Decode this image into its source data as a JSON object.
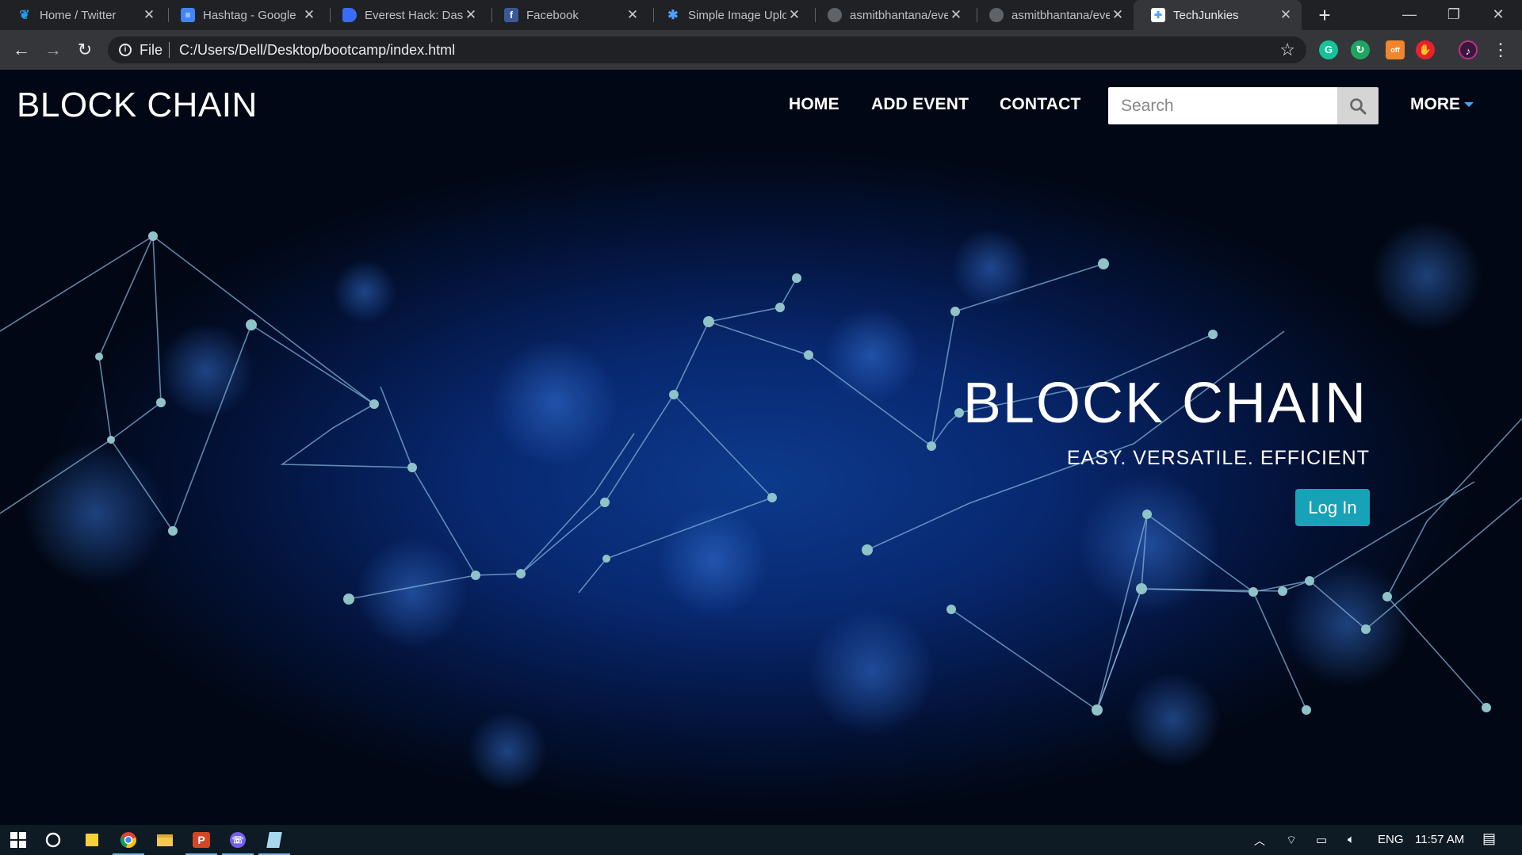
{
  "browser": {
    "tabs": [
      {
        "title": "Home / Twitter",
        "icon": "twitter-icon",
        "color": "#1da1f2",
        "glyph": "t"
      },
      {
        "title": "Hashtag - Google",
        "icon": "google-docs-icon",
        "color": "#4285f4",
        "glyph": "≡"
      },
      {
        "title": "Everest Hack: Dash",
        "icon": "everest-hack-icon",
        "color": "#3b6cf6",
        "glyph": "D"
      },
      {
        "title": "Facebook",
        "icon": "facebook-icon",
        "color": "#3b5998",
        "glyph": "f"
      },
      {
        "title": "Simple Image Uplo",
        "icon": "loading-spinner-icon",
        "color": "#202124",
        "glyph": "✱"
      },
      {
        "title": "asmitbhantana/eve",
        "icon": "github-icon",
        "color": "#202124",
        "glyph": "●"
      },
      {
        "title": "asmitbhantana/eve",
        "icon": "github-icon",
        "color": "#202124",
        "glyph": "●"
      },
      {
        "title": "TechJunkies",
        "icon": "techjunkies-icon",
        "color": "#ffffff",
        "glyph": "✚"
      }
    ],
    "active_tab": 7,
    "address": {
      "scheme": "File",
      "url": "C:/Users/Dell/Desktop/bootcamp/index.html"
    }
  },
  "page": {
    "brand": "BLOCK CHAIN",
    "nav": [
      "HOME",
      "ADD EVENT",
      "CONTACT"
    ],
    "search": {
      "placeholder": "Search"
    },
    "more": "MORE",
    "hero": {
      "title": "BLOCK CHAIN",
      "subtitle": "EASY. VERSATILE. EFFICIENT",
      "button": "Log In"
    },
    "accent_color": "#17a2b8"
  },
  "taskbar": {
    "language": "ENG",
    "time": "11:57 AM"
  }
}
